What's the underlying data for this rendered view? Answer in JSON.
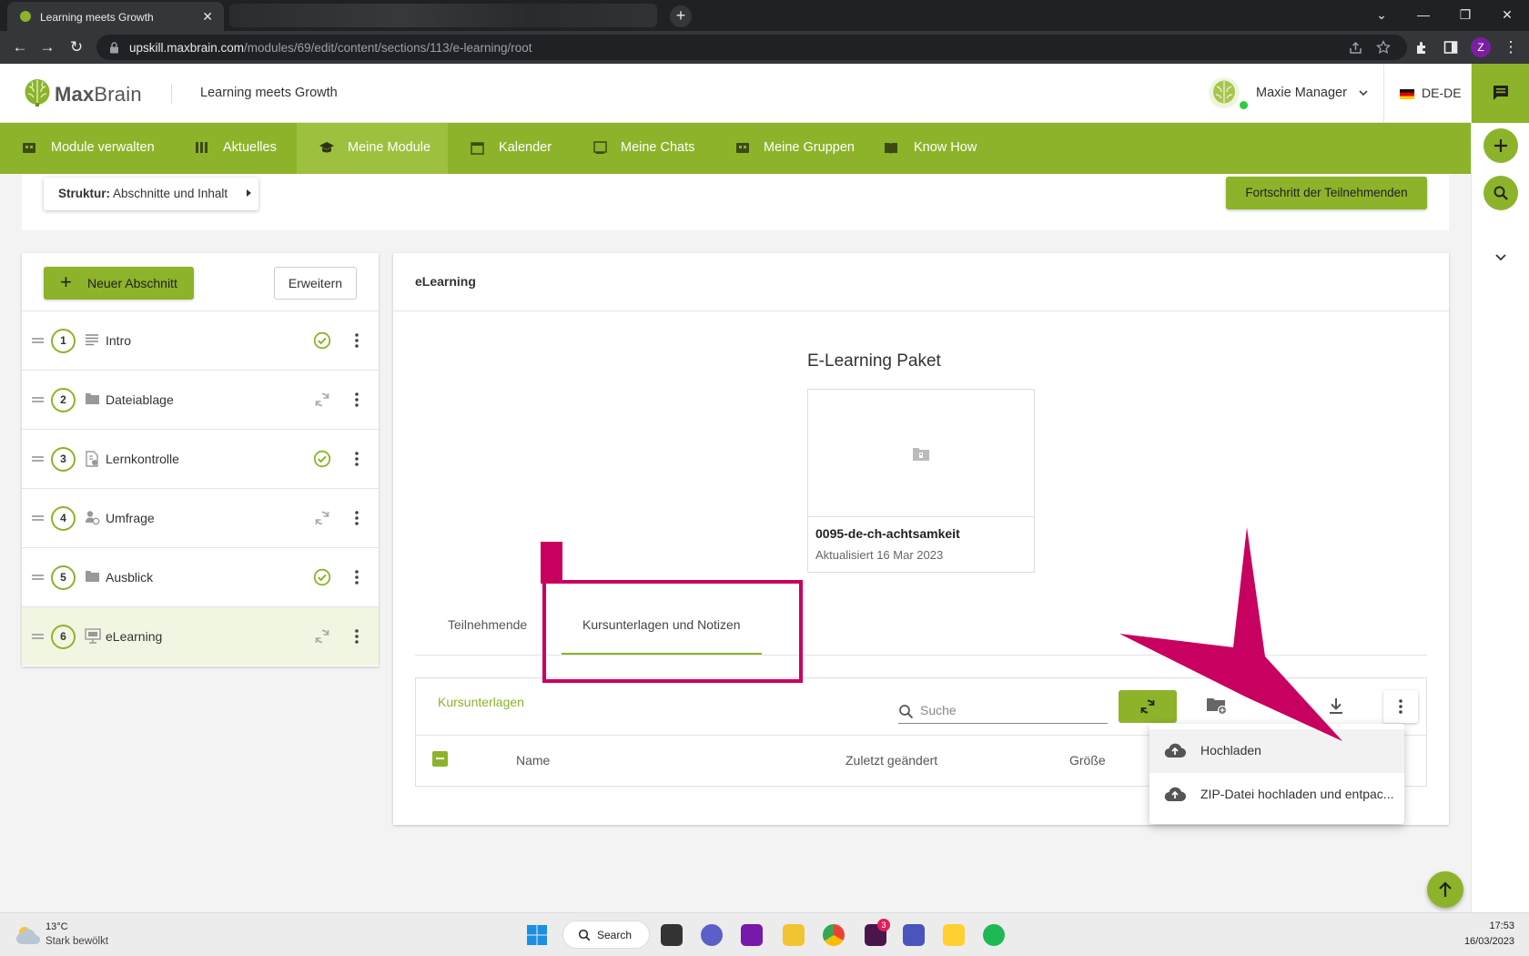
{
  "browser": {
    "tab_title": "Learning meets Growth",
    "url_host": "upskill.maxbrain.com",
    "url_path": "/modules/69/edit/content/sections/113/e-learning/root",
    "profile_initial": "Z"
  },
  "header": {
    "logo_bold": "Max",
    "logo_rest": "Brain",
    "tagline": "Learning meets Growth",
    "user_name": "Maxie Manager",
    "language": "DE-DE"
  },
  "nav": {
    "items": [
      {
        "label": "Module verwalten",
        "icon": "module-manage-icon"
      },
      {
        "label": "Aktuelles",
        "icon": "news-icon"
      },
      {
        "label": "Meine Module",
        "icon": "graduation-cap-icon"
      },
      {
        "label": "Kalender",
        "icon": "calendar-icon"
      },
      {
        "label": "Meine Chats",
        "icon": "chat-icon"
      },
      {
        "label": "Meine Gruppen",
        "icon": "groups-icon"
      },
      {
        "label": "Know How",
        "icon": "book-icon"
      }
    ],
    "active": "Meine Module"
  },
  "structure": {
    "label_bold": "Struktur:",
    "label_value": "Abschnitte und Inhalt",
    "progress_button": "Fortschritt der Teilnehmenden"
  },
  "sections": {
    "new_button": "Neuer Abschnitt",
    "expand_button": "Erweitern",
    "items": [
      {
        "number": "1",
        "label": "Intro",
        "icon": "text-lines-icon",
        "status": "published"
      },
      {
        "number": "2",
        "label": "Dateiablage",
        "icon": "folder-icon",
        "status": "sync"
      },
      {
        "number": "3",
        "label": "Lernkontrolle",
        "icon": "quiz-icon",
        "status": "published"
      },
      {
        "number": "4",
        "label": "Umfrage",
        "icon": "survey-icon",
        "status": "sync"
      },
      {
        "number": "5",
        "label": "Ausblick",
        "icon": "folder-icon",
        "status": "published"
      },
      {
        "number": "6",
        "label": "eLearning",
        "icon": "monitor-icon",
        "status": "sync"
      }
    ],
    "selected": "eLearning"
  },
  "main": {
    "title": "eLearning",
    "package_heading": "E-Learning Paket",
    "package_name": "0095-de-ch-achtsamkeit",
    "package_updated": "Aktualisiert 16 Mar 2023",
    "tabs": [
      "Teilnehmende",
      "Kursunterlagen und Notizen"
    ],
    "active_tab": "Kursunterlagen und Notizen",
    "files": {
      "title": "Kursunterlagen",
      "search_placeholder": "Suche",
      "columns": [
        "Name",
        "Zuletzt geändert",
        "Größe"
      ]
    },
    "menu": {
      "items": [
        "Hochladen",
        "ZIP-Datei hochladen und entpac..."
      ]
    }
  },
  "taskbar": {
    "temperature": "13°C",
    "weather": "Stark bewölkt",
    "search_label": "Search",
    "slack_badge": "3",
    "time": "17:53",
    "date": "16/03/2023"
  },
  "colors": {
    "brand_green": "#8db32a",
    "highlight_magenta": "#c8005f"
  }
}
